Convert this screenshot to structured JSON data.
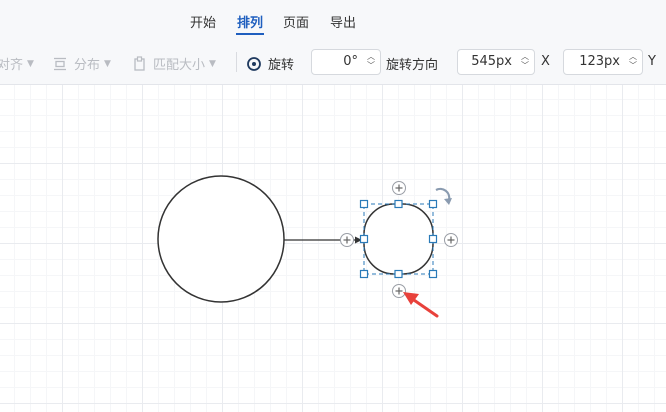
{
  "tabs": [
    {
      "label": "开始",
      "active": false
    },
    {
      "label": "排列",
      "active": true
    },
    {
      "label": "页面",
      "active": false
    },
    {
      "label": "导出",
      "active": false
    }
  ],
  "toolbar": {
    "align_label": "对齐",
    "distribute_label": "分布",
    "match_size_label": "匹配大小",
    "rotate_label": "旋转",
    "rotation_value": "0°",
    "rotation_direction_label": "旋转方向",
    "x_value": "545px",
    "x_label": "X",
    "y_value": "123px",
    "y_label": "Y"
  },
  "colors": {
    "accent": "#1f5fbf",
    "selection": "#2a7ab8",
    "annotation_arrow": "#e8413b"
  }
}
